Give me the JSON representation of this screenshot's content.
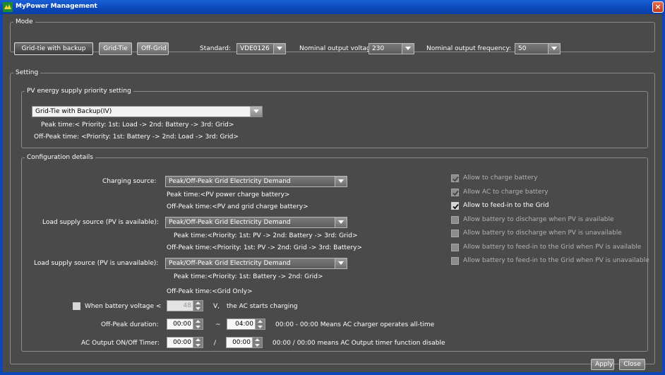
{
  "window": {
    "title": "MyPower Management"
  },
  "mode": {
    "legend": "Mode",
    "buttons": [
      "Grid-tie with backup",
      "Grid-Tie",
      "Off-Grid"
    ],
    "standard_label": "Standard:",
    "standard_value": "VDE0126",
    "voltage_label": "Nominal output voltage:",
    "voltage_value": "230",
    "frequency_label": "Nominal output frequency:",
    "frequency_value": "50"
  },
  "setting": {
    "legend": "Setting",
    "pv": {
      "legend": "PV energy supply priority setting",
      "value": "Grid-Tie with Backup(IV)",
      "peak": "Peak time:< Priority: 1st: Load -> 2nd: Battery -> 3rd: Grid>",
      "offpeak": "Off-Peak time: <Priority: 1st: Battery -> 2nd: Load -> 3rd: Grid>"
    },
    "config": {
      "legend": "Configuration details",
      "charging": {
        "label": "Charging source:",
        "value": "Peak/Off-Peak Grid Electricity Demand",
        "peak": "Peak time:<PV power charge battery>",
        "offpeak": "Off-Peak time:<PV and grid charge battery>"
      },
      "load_avail": {
        "label": "Load supply source (PV is available):",
        "value": "Peak/Off-Peak Grid Electricity Demand",
        "peak": "Peak time:<Priority: 1st: PV -> 2nd: Battery -> 3rd: Grid>",
        "offpeak": "Off-Peak time:<Priority: 1st: PV -> 2nd: Grid -> 3rd: Battery>"
      },
      "load_unavail": {
        "label": "Load supply source (PV is unavailable):",
        "value": "Peak/Off-Peak Grid Electricity Demand",
        "peak": "Peak time:<Priority: 1st: Battery -> 2nd: Grid>",
        "offpeak": "Off-Peak time:<Grid Only>"
      },
      "battery": {
        "label": "When battery voltage <",
        "value": "48",
        "unit": "V,",
        "suffix": "the AC starts charging"
      },
      "offpeak_duration": {
        "label": "Off-Peak duration:",
        "start": "00:00",
        "sep": "~",
        "end": "04:00",
        "note": "00:00 - 00:00 Means AC charger operates all-time"
      },
      "ac_timer": {
        "label": "AC Output ON/Off Timer:",
        "on": "00:00",
        "sep": "/",
        "off": "00:00",
        "note": "00:00 / 00:00 means AC Output timer function disable"
      },
      "options": [
        {
          "label": "Allow to charge battery",
          "checked": true,
          "enabled": false
        },
        {
          "label": "Allow AC to charge battery",
          "checked": true,
          "enabled": false
        },
        {
          "label": "Allow to feed-in to the Grid",
          "checked": true,
          "enabled": true
        },
        {
          "label": "Allow battery to discharge when PV is available",
          "checked": false,
          "enabled": false
        },
        {
          "label": "Allow battery to discharge when PV is unavailable",
          "checked": false,
          "enabled": false
        },
        {
          "label": "Allow battery to feed-in to the Grid when PV is available",
          "checked": false,
          "enabled": false
        },
        {
          "label": "Allow battery to feed-in to the Grid when PV is unavailable",
          "checked": false,
          "enabled": false
        }
      ]
    }
  },
  "footer": {
    "apply": "Apply",
    "close": "Close"
  }
}
